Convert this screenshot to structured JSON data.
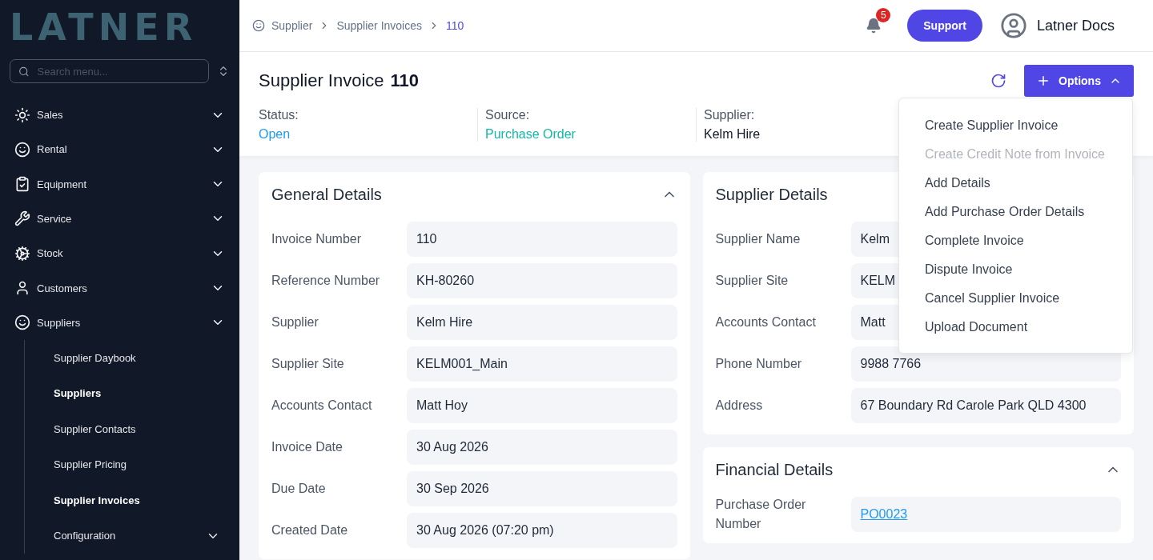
{
  "logo": "LATNER",
  "search": {
    "placeholder": "Search menu..."
  },
  "nav": [
    {
      "label": "Sales"
    },
    {
      "label": "Rental"
    },
    {
      "label": "Equipment"
    },
    {
      "label": "Service"
    },
    {
      "label": "Stock"
    },
    {
      "label": "Customers"
    },
    {
      "label": "Suppliers",
      "children": [
        {
          "label": "Supplier Daybook",
          "selected": false
        },
        {
          "label": "Suppliers",
          "selected": true
        },
        {
          "label": "Supplier Contacts",
          "selected": false
        },
        {
          "label": "Supplier Pricing",
          "selected": false
        },
        {
          "label": "Supplier Invoices",
          "selected": true
        },
        {
          "label": "Configuration",
          "selected": false,
          "has_children": true
        }
      ]
    }
  ],
  "breadcrumb": [
    "Supplier",
    "Supplier Invoices",
    "110"
  ],
  "notifications": "5",
  "support": "Support",
  "user": "Latner Docs",
  "title": "Supplier Invoice",
  "number": "110",
  "summary": [
    {
      "label": "Status:",
      "value": "Open",
      "kind": "status"
    },
    {
      "label": "Source:",
      "value": "Purchase Order",
      "kind": "source"
    },
    {
      "label": "Supplier:",
      "value": "Kelm Hire",
      "kind": "party"
    }
  ],
  "options": {
    "label": "Options",
    "open": true,
    "items": [
      {
        "label": "Create Supplier Invoice",
        "disabled": false
      },
      {
        "label": "Create Credit Note from Invoice",
        "disabled": true
      },
      {
        "label": "Add Details",
        "disabled": false
      },
      {
        "label": "Add Purchase Order Details",
        "disabled": false
      },
      {
        "label": "Complete Invoice",
        "disabled": false
      },
      {
        "label": "Dispute Invoice",
        "disabled": false
      },
      {
        "label": "Cancel Supplier Invoice",
        "disabled": false
      },
      {
        "label": "Upload Document",
        "disabled": false
      }
    ]
  },
  "general": {
    "title": "General Details",
    "expanded": true,
    "fields": [
      {
        "label": "Invoice Number",
        "value": "110"
      },
      {
        "label": "Reference Number",
        "value": "KH-80260"
      },
      {
        "label": "Supplier",
        "value": "Kelm Hire"
      },
      {
        "label": "Supplier Site",
        "value": "KELM001_Main"
      },
      {
        "label": "Accounts Contact",
        "value": "Matt Hoy"
      },
      {
        "label": "Invoice Date",
        "value": "30 Aug 2026"
      },
      {
        "label": "Due Date",
        "value": "30 Sep 2026"
      },
      {
        "label": "Created Date",
        "value": "30 Aug 2026 (07:20 pm)"
      }
    ]
  },
  "supplier": {
    "title": "Supplier Details",
    "fields": [
      {
        "label": "Supplier Name",
        "value": "Kelm"
      },
      {
        "label": "Supplier Site",
        "value": "KELM"
      },
      {
        "label": "Accounts Contact",
        "value": "Matt"
      },
      {
        "label": "Phone Number",
        "value": "9988 7766"
      },
      {
        "label": "Address",
        "value": "67 Boundary Rd Carole Park QLD 4300"
      }
    ]
  },
  "financial": {
    "title": "Financial Details",
    "expanded": true,
    "fields": [
      {
        "label": "Purchase Order Number",
        "value": "PO0023",
        "kind": "link"
      }
    ]
  }
}
